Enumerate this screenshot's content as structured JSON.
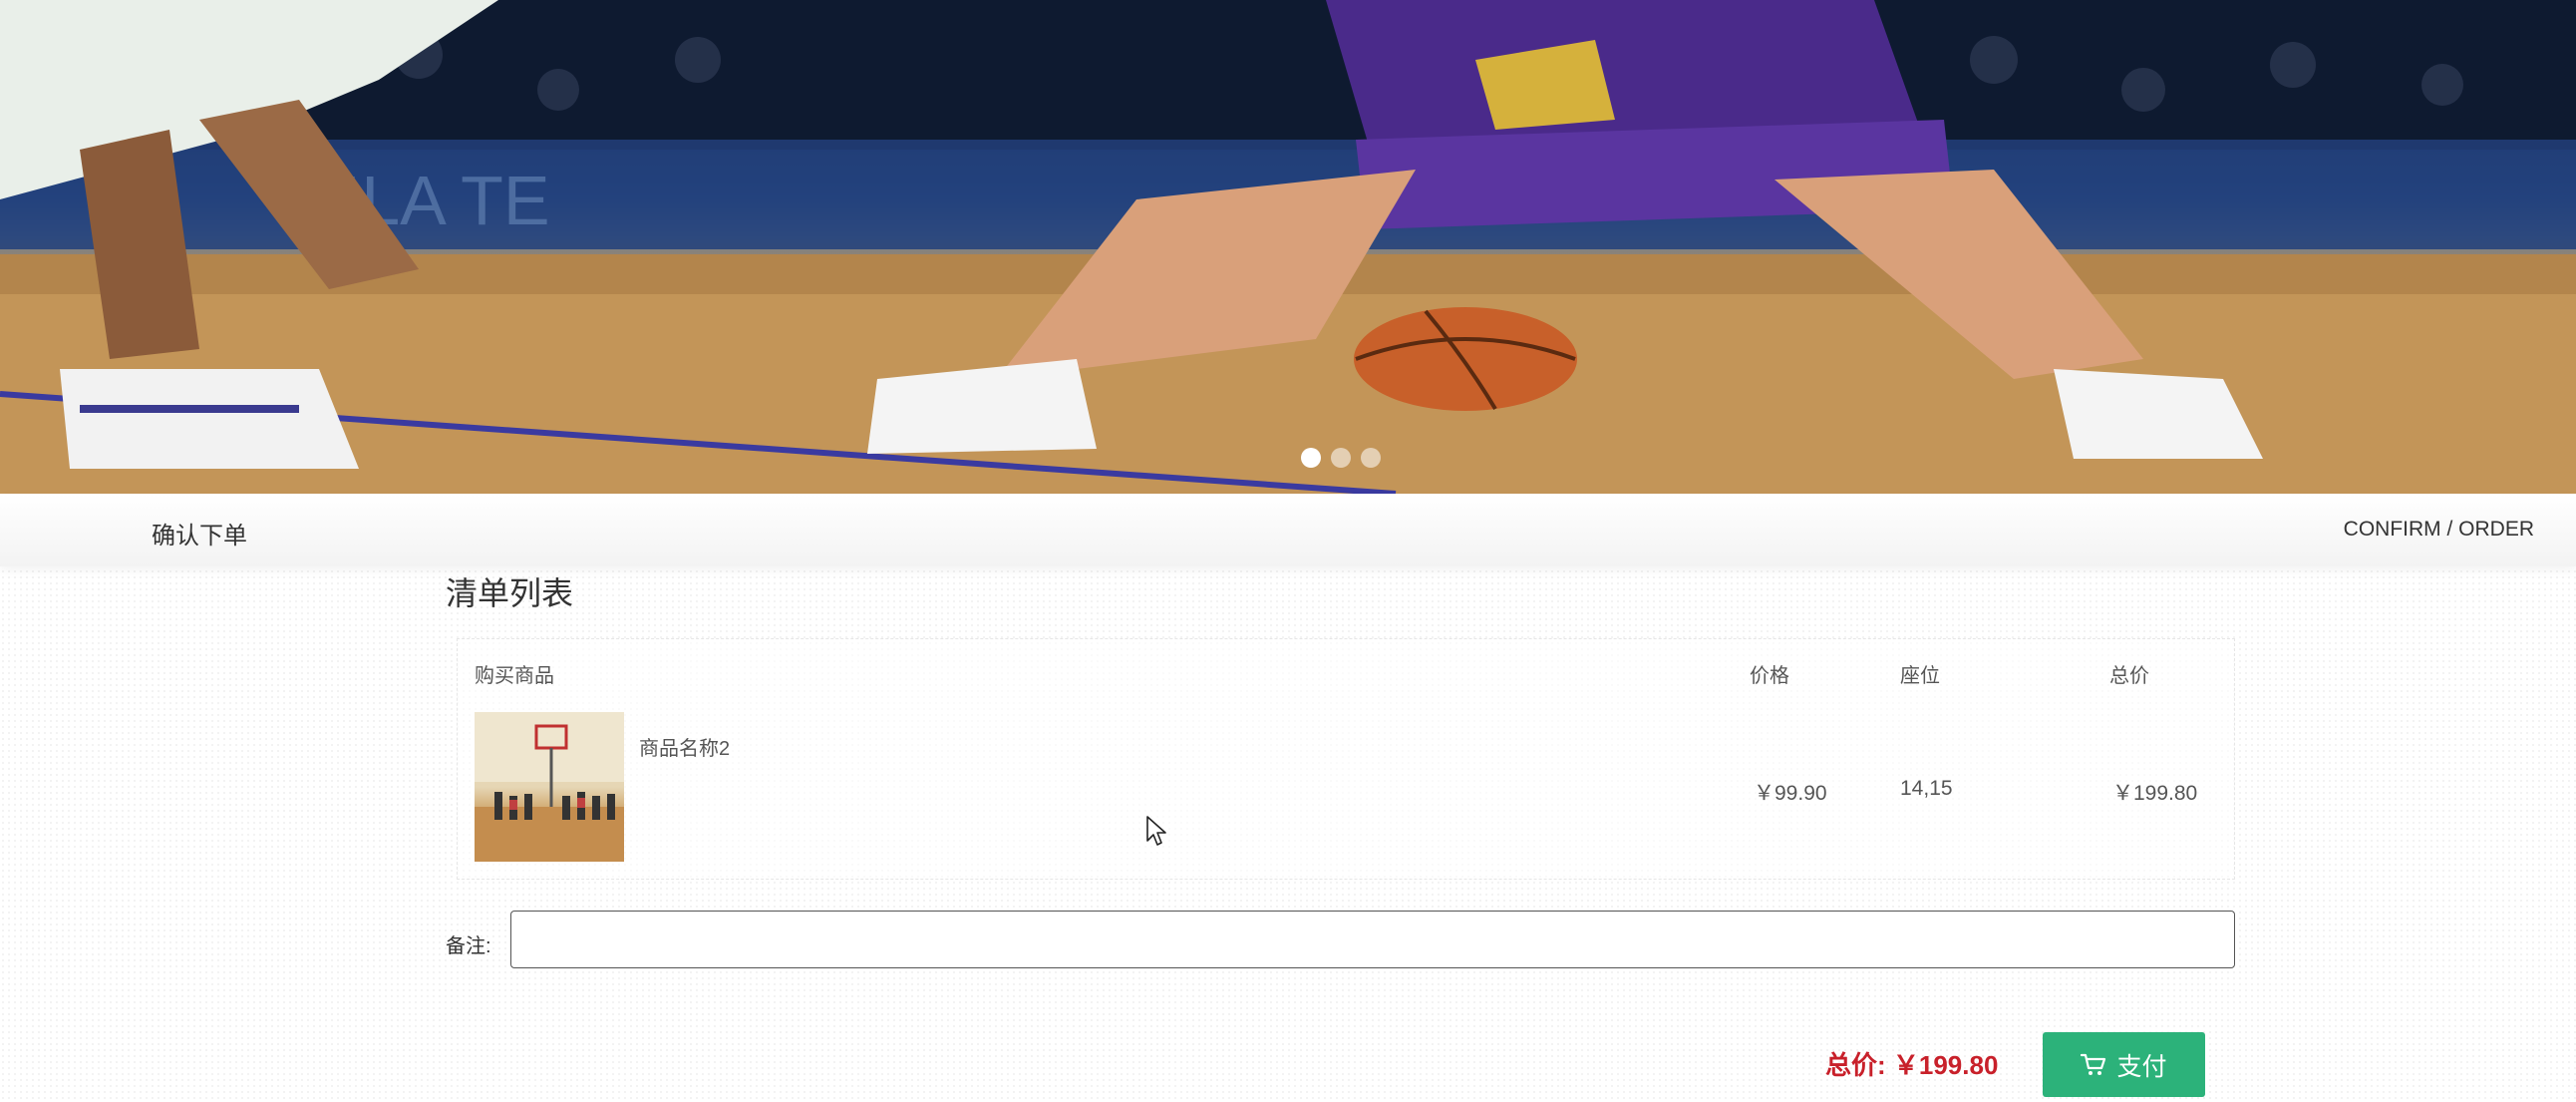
{
  "banner": {
    "image": "basketball-game-photo",
    "slides": 3,
    "active_slide": 1
  },
  "confirm_bar": {
    "title": "确认下单",
    "subtitle": "CONFIRM / ORDER"
  },
  "order": {
    "section_title": "清单列表",
    "columns": {
      "goods": "购买商品",
      "price": "价格",
      "seat": "座位",
      "total": "总价"
    },
    "items": [
      {
        "name": "商品名称2",
        "price": "￥99.90",
        "seat": "14,15",
        "total": "￥199.80",
        "thumbnail": "kids-basketball-court-photo"
      }
    ]
  },
  "remark": {
    "label": "备注:",
    "value": ""
  },
  "summary": {
    "total_label": "总价: ￥199.80"
  },
  "pay_button": {
    "label": "支付",
    "icon": "cart-icon"
  },
  "colors": {
    "accent_green": "#2cb27a",
    "total_red": "#c8202a"
  }
}
